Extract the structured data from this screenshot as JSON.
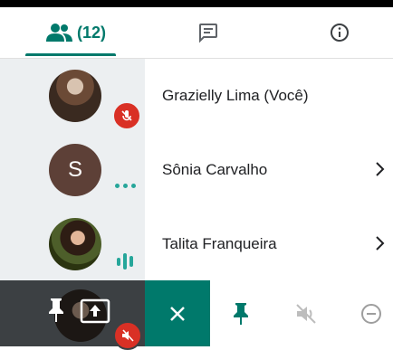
{
  "tabs": {
    "people_count": "(12)",
    "icons": [
      "people-icon",
      "chat-icon",
      "info-icon"
    ]
  },
  "participants": [
    {
      "name": "Grazielly Lima (Você)",
      "avatar": "photo",
      "status": "muted"
    },
    {
      "name": "Sônia Carvalho",
      "avatar_letter": "S",
      "status": "typing-dots"
    },
    {
      "name": "Talita Franqueira",
      "avatar": "photo",
      "status": "speaking"
    }
  ],
  "colors": {
    "accent": "#00796b",
    "muted_red": "#d93025",
    "panel_bg": "#eceff1",
    "bottom_dark": "#3c4043"
  }
}
